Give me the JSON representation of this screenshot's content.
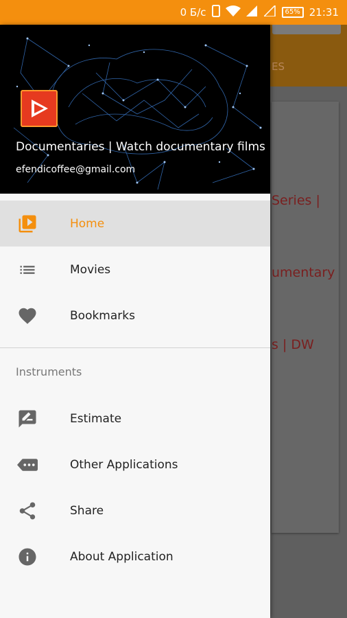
{
  "status_bar": {
    "speed": "0 Б/с",
    "battery": "65%",
    "time": "21:31"
  },
  "header": {
    "title": "Documentaries | Watch documentary films",
    "email": "efendicoffee@gmail.com"
  },
  "menu": {
    "main": [
      {
        "label": "Home",
        "icon": "video-library-icon",
        "active": true
      },
      {
        "label": "Movies",
        "icon": "list-icon",
        "active": false
      },
      {
        "label": "Bookmarks",
        "icon": "heart-icon",
        "active": false
      }
    ],
    "section_title": "Instruments",
    "tools": [
      {
        "label": "Estimate",
        "icon": "rate-review-icon"
      },
      {
        "label": "Other Applications",
        "icon": "more-apps-icon"
      },
      {
        "label": "Share",
        "icon": "share-icon"
      },
      {
        "label": "About Application",
        "icon": "info-icon"
      }
    ]
  },
  "background": {
    "tab_fragment": "ES",
    "list_fragments": [
      "Series |",
      "umentary",
      "s | DW"
    ]
  },
  "colors": {
    "accent": "#f48f0e",
    "drawer_bg": "#f7f7f7",
    "active_bg": "#e0e0e0"
  }
}
